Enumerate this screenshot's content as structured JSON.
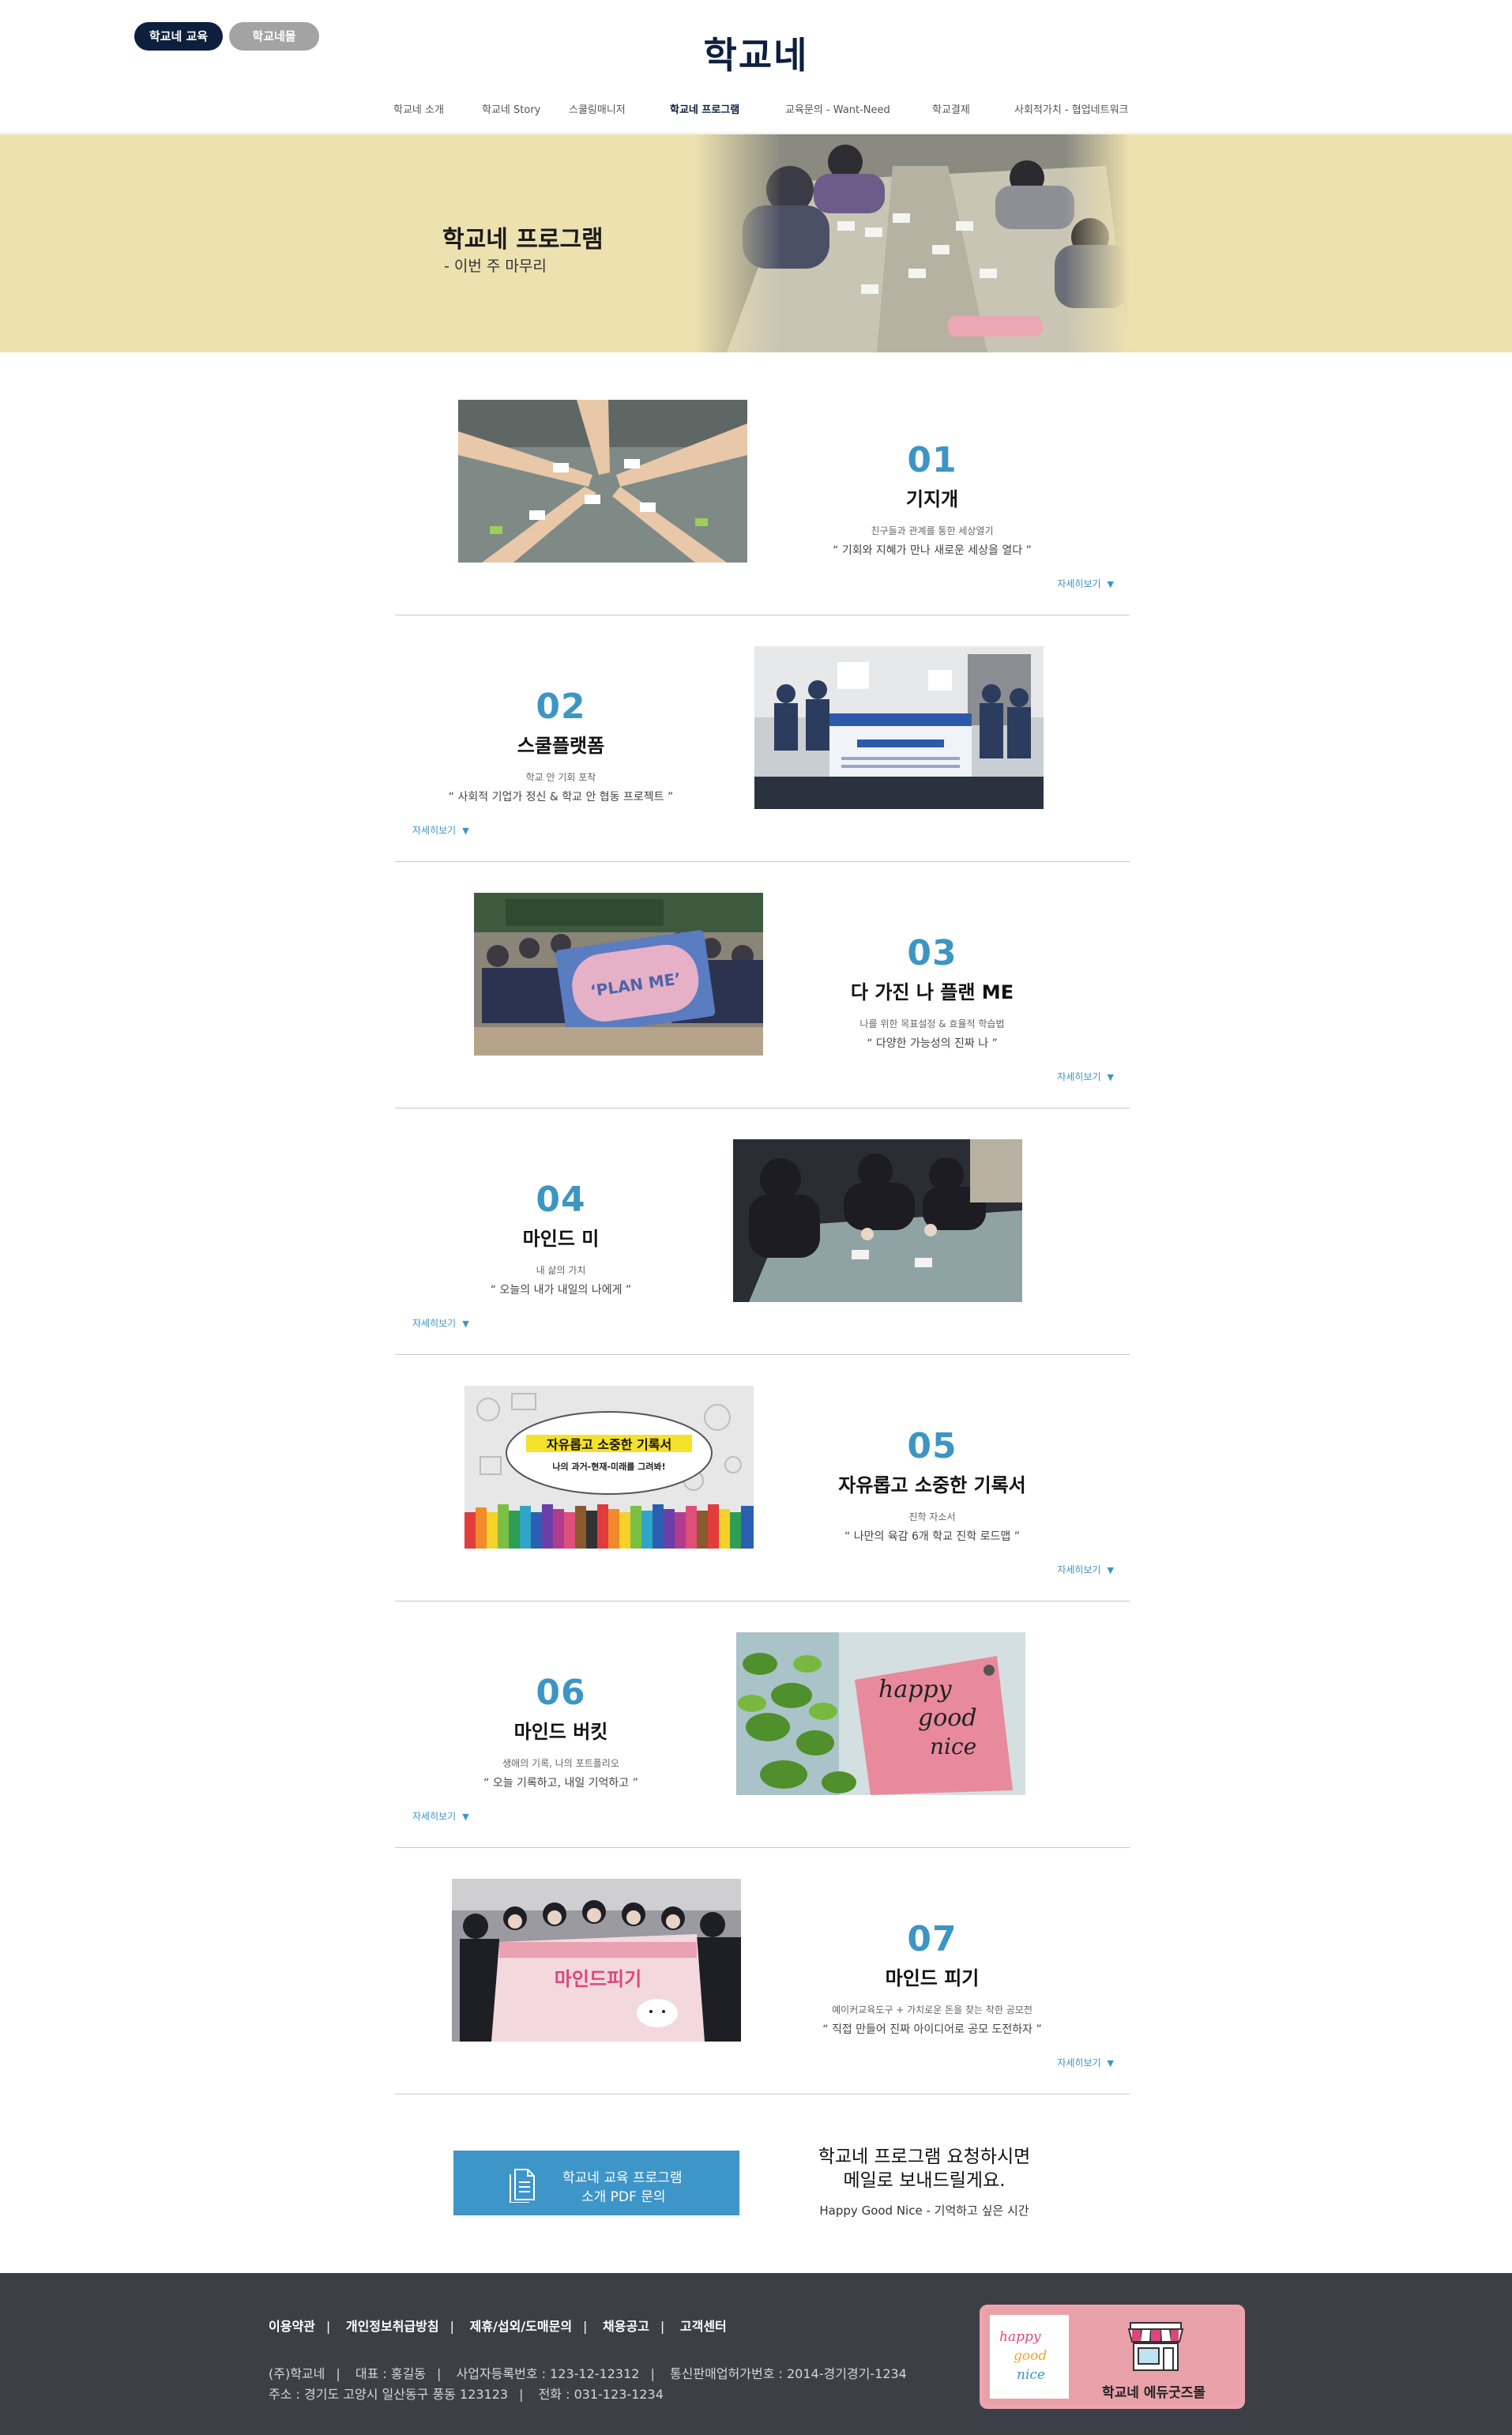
{
  "header": {
    "logo": "학교네",
    "pill_edu": "학교네 교육",
    "pill_mall": "학교네몰",
    "nav": [
      {
        "label": "학교네 소개"
      },
      {
        "label": "학교네 Story"
      },
      {
        "label": "스쿨링매니저"
      },
      {
        "label": "학교네 프로그램",
        "active": true
      },
      {
        "label": "교육문의 - Want-Need"
      },
      {
        "label": "학교결제"
      },
      {
        "label": "사회적가치 - 협업네트워크"
      }
    ]
  },
  "hero": {
    "title": "학교네 프로그램",
    "subtitle": "- 이번 주 마무리"
  },
  "programs": [
    {
      "num": "01",
      "name": "기지개",
      "desc": "친구들과 관계를 통한 세상열기",
      "quote": "“ 기회와 지혜가 만나 새로운 세상을 열다 ”",
      "more": "자세히보기"
    },
    {
      "num": "02",
      "name": "스쿨플랫폼",
      "desc": "학교 안 기회 포착",
      "quote": "“ 사회적 기업가 정신 & 학교 안 협동 프로젝트 ”",
      "more": "자세히보기"
    },
    {
      "num": "03",
      "name": "다 가진 나 플랜 ME",
      "desc": "나를 위한 목표설정 & 효율적 학습법",
      "quote": "“ 다양한 가능성의 진짜 나 ”",
      "more": "자세히보기"
    },
    {
      "num": "04",
      "name": "마인드 미",
      "desc": "내 삶의 가치",
      "quote": "“ 오늘의 내가 내일의 나에게 ”",
      "more": "자세히보기"
    },
    {
      "num": "05",
      "name": "자유롭고 소중한 기록서",
      "desc": "진학 자소서",
      "quote": "“ 나만의 육감 6개 학교 진학 로드맵 ”",
      "more": "자세히보기"
    },
    {
      "num": "06",
      "name": "마인드 버킷",
      "desc": "생애의 기록, 나의 포트폴리오",
      "quote": "“ 오늘 기록하고, 내일 기억하고 ”",
      "more": "자세히보기"
    },
    {
      "num": "07",
      "name": "마인드 피기",
      "desc": "예이커교육도구 + 가치로운 돈을 찾는 착한 공모전",
      "quote": "“ 직접 만들어 진짜 아이디어로 공모 도전하자 ”",
      "more": "자세히보기"
    }
  ],
  "images": {
    "p3_banner": "‘PLAN ME’",
    "p5_title": "자유롭고 소중한 기록서",
    "p5_sub": "나의 과거-현재-미래를 그려봐!",
    "p6_words": [
      "happy",
      "good",
      "nice"
    ],
    "p7_banner": "마인드피기"
  },
  "cta": {
    "button_line1": "학교네 교육 프로그램",
    "button_line2": "소개 PDF 문의",
    "line1": "학교네 프로그램 요청하시면",
    "line2": "메일로 보내드릴게요.",
    "line3": "Happy Good Nice - 기억하고 싶은 시간"
  },
  "footer": {
    "links": [
      "이용약관",
      "개인정보취급방침",
      "제휴/섭외/도매문의",
      "채용공고",
      "고객센터"
    ],
    "info1": [
      "(주)학교네",
      "대표 : 홍길동",
      "사업자등록번호 : 123-12-12312",
      "통신판매업허가번호 : 2014-경기경기-1234"
    ],
    "info2": [
      "주소 : 경기도 고양시 일산동구 풍동 123123",
      "전화 : 031-123-1234"
    ],
    "goods_label": "학교네 에듀굿즈몰",
    "goods_logo": [
      "happy",
      "good",
      "nice"
    ]
  },
  "colors": {
    "navy": "#0d1f3d",
    "accent_blue": "#3d95c4",
    "hero_bg": "#ede1b0",
    "footer_bg": "#3c4046",
    "goods_pink": "#e8a1a8"
  }
}
